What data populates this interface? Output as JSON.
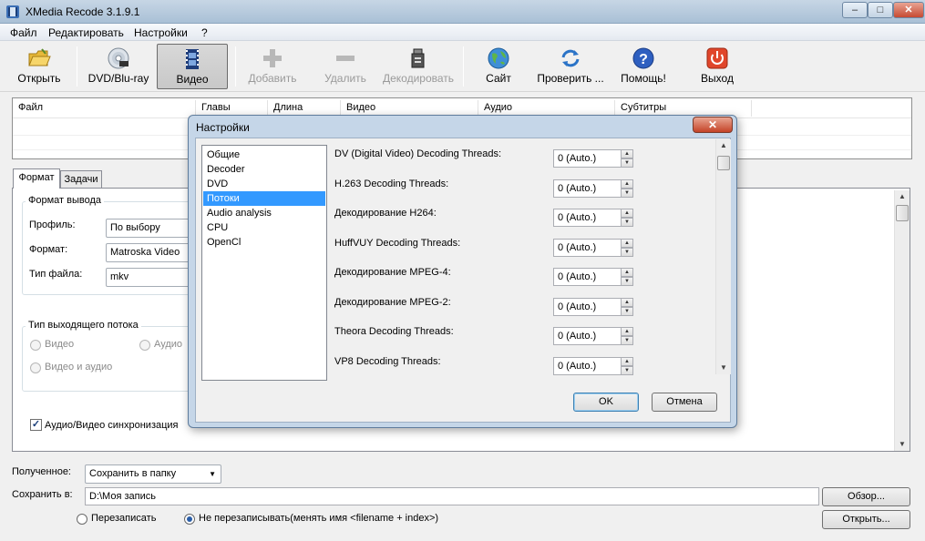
{
  "window": {
    "title": "XMedia Recode 3.1.9.1",
    "min": "–",
    "max": "□",
    "close": "✕"
  },
  "menu": [
    "Файл",
    "Редактировать",
    "Настройки",
    "?"
  ],
  "toolbar": {
    "open": "Открыть",
    "dvd": "DVD/Blu-ray",
    "video": "Видео",
    "add": "Добавить",
    "remove": "Удалить",
    "decode": "Декодировать",
    "site": "Сайт",
    "check": "Проверить ...",
    "help": "Помощь!",
    "exit": "Выход"
  },
  "file_table": {
    "columns": [
      "Файл",
      "Главы",
      "Длина",
      "Видео",
      "Аудио",
      "Субтитры"
    ]
  },
  "tabs": [
    "Формат",
    "Задачи"
  ],
  "format": {
    "group_output": "Формат вывода",
    "profile_label": "Профиль:",
    "profile_value": "По выбору",
    "format_label": "Формат:",
    "format_value": "Matroska Video",
    "filetype_label": "Тип файла:",
    "filetype_value": "mkv",
    "group_stream": "Тип выходящего потока",
    "stream_video": "Видео",
    "stream_audio": "Аудио",
    "stream_both": "Видео и аудио",
    "sync_label": "Аудио/Видео синхронизация"
  },
  "bottom": {
    "received_label": "Полученное:",
    "received_value": "Сохранить в папку",
    "save_label": "Сохранить в:",
    "save_path": "D:\\Моя запись",
    "browse": "Обзор...",
    "open": "Открыть...",
    "overwrite": "Перезаписать",
    "no_overwrite": "Не перезаписывать(менять имя <filename + index>)"
  },
  "dialog": {
    "title": "Настройки",
    "close": "✕",
    "categories": [
      "Общие",
      "Decoder",
      "DVD",
      "Потоки",
      "Audio analysis",
      "CPU",
      "OpenCl"
    ],
    "selected_category": "Потоки",
    "settings": [
      {
        "label": "DV (Digital Video) Decoding Threads:",
        "value": "0 (Auto.)"
      },
      {
        "label": "H.263 Decoding Threads:",
        "value": "0 (Auto.)"
      },
      {
        "label": "Декодирование H264:",
        "value": "0 (Auto.)"
      },
      {
        "label": "HuffVUY Decoding Threads:",
        "value": "0 (Auto.)"
      },
      {
        "label": "Декодирование MPEG-4:",
        "value": "0 (Auto.)"
      },
      {
        "label": "Декодирование MPEG-2:",
        "value": "0 (Auto.)"
      },
      {
        "label": "Theora Decoding Threads:",
        "value": "0 (Auto.)"
      },
      {
        "label": "VP8 Decoding Threads:",
        "value": "0 (Auto.)"
      }
    ],
    "ok": "OK",
    "cancel": "Отмена"
  },
  "icons": {
    "open": "folder-icon",
    "dvd": "disc-icon",
    "video": "film-icon",
    "add": "plus-icon",
    "remove": "minus-icon",
    "decode": "decode-icon",
    "site": "globe-icon",
    "check": "refresh-icon",
    "help": "help-icon",
    "exit": "power-icon"
  },
  "colors": {
    "selection": "#3399ff",
    "title_bar": "#b9cde1",
    "close_button": "#c44327"
  }
}
